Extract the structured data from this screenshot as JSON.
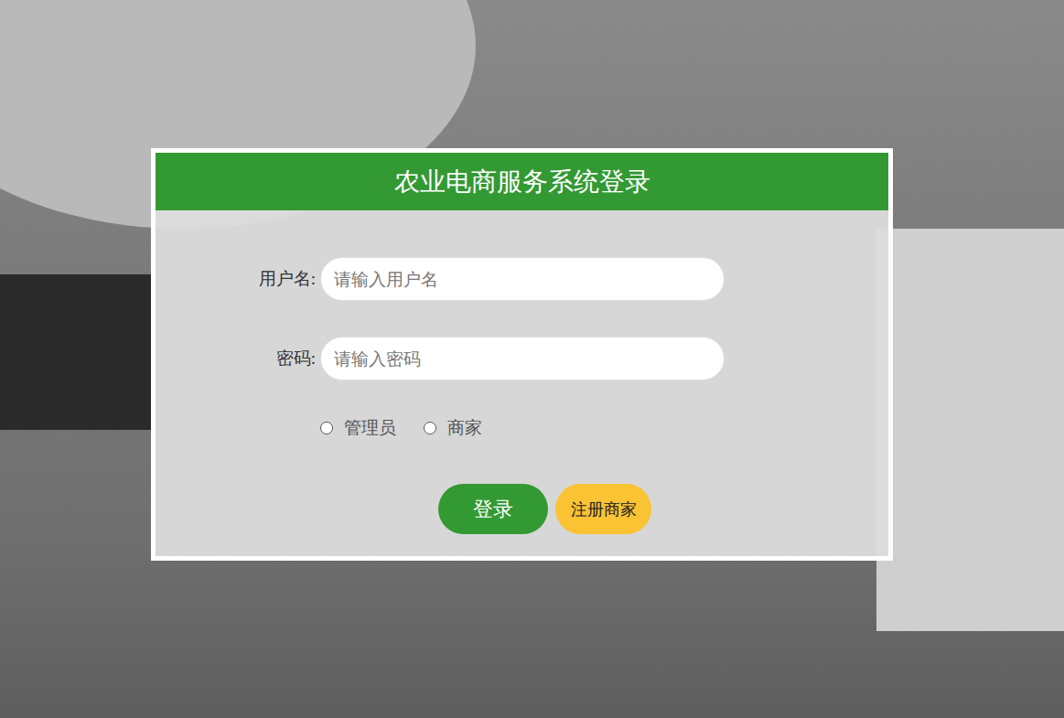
{
  "window": {
    "title": "农业电商服务系统登录"
  },
  "fields": [
    {
      "label": "用户名:",
      "placeholder": "请输入用户名",
      "kind": "text"
    },
    {
      "label": "密码:",
      "placeholder": "请输入密码",
      "kind": "password"
    }
  ],
  "roles": [
    {
      "label": "管理员",
      "selected": false
    },
    {
      "label": "商家",
      "selected": false
    }
  ],
  "buttons": [
    {
      "label": "登录",
      "kind": "primary"
    },
    {
      "label": "注册商家",
      "kind": "secondary"
    }
  ]
}
